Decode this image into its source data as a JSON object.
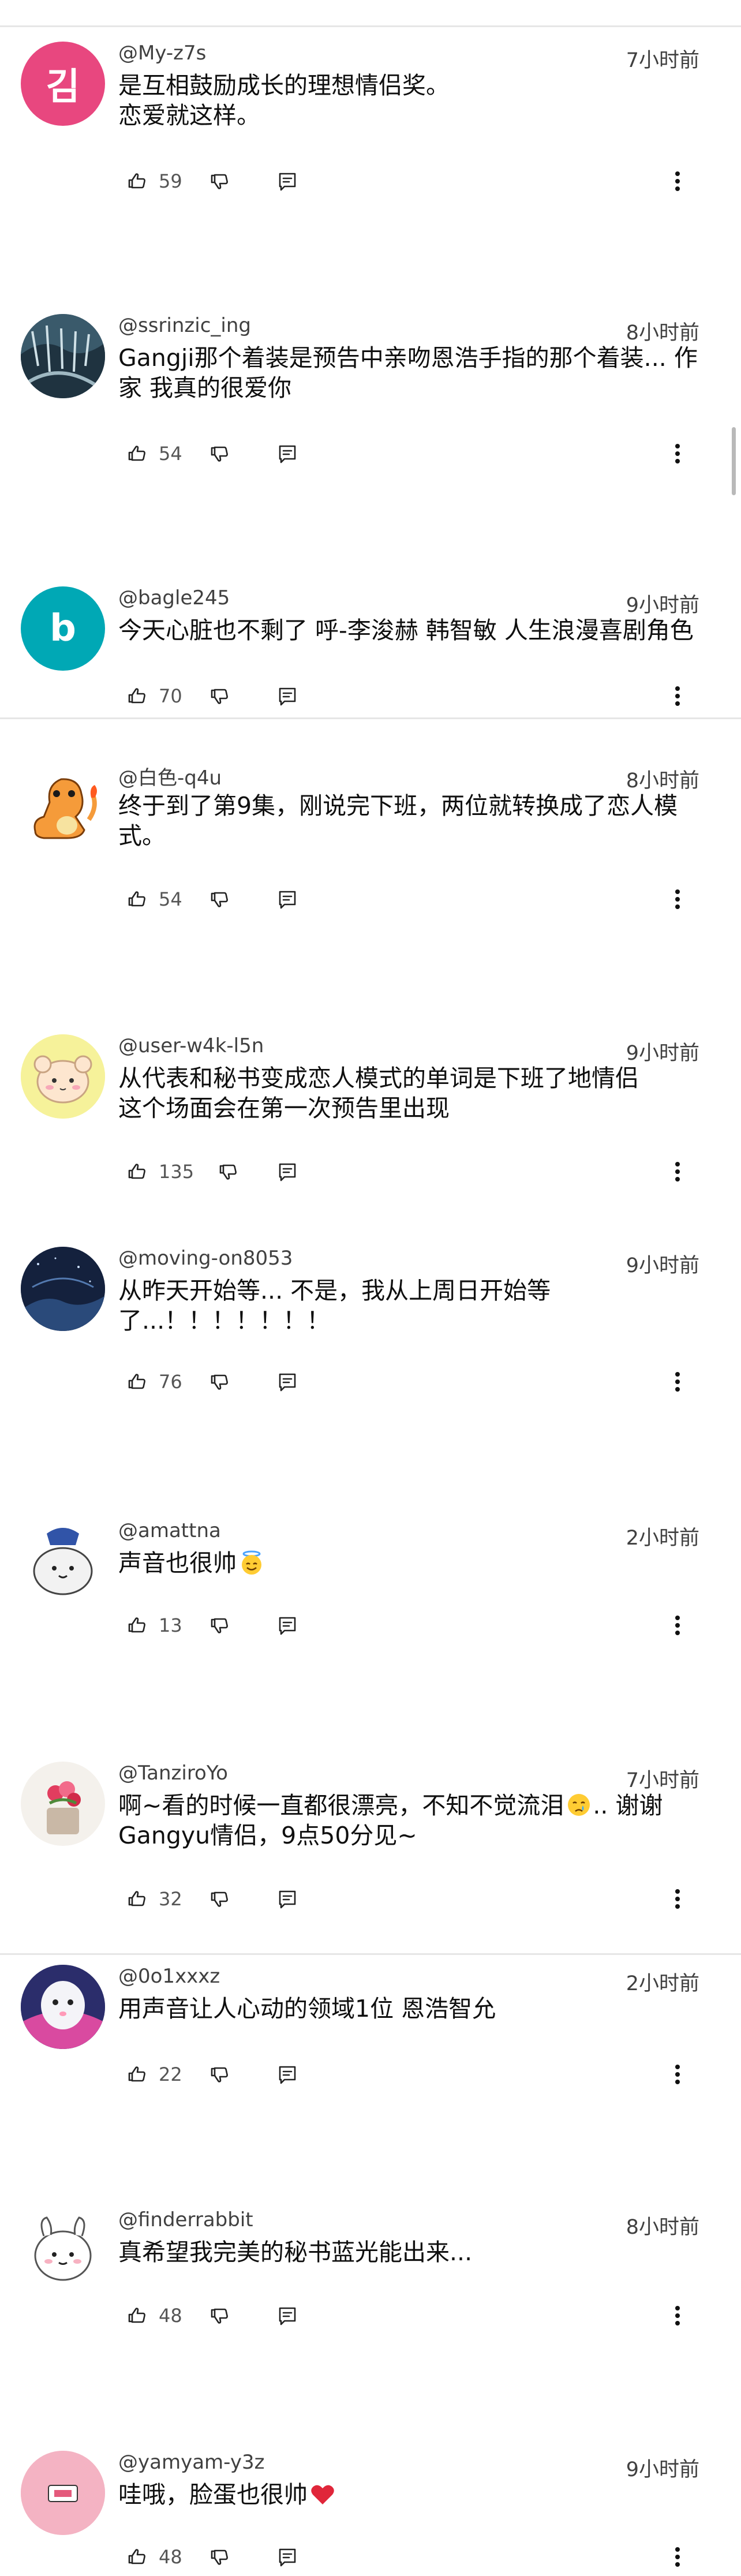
{
  "colors": {
    "text": "#0f0f0f",
    "meta": "#404040",
    "divider": "#e6e6e6",
    "avatar_letter_bg": "#e8477f",
    "avatar_b_bg": "#00a8b5"
  },
  "icons": {
    "like": "thumb-up-icon",
    "dislike": "thumb-down-icon",
    "reply": "reply-icon",
    "more": "more-vert-icon"
  },
  "comments": [
    {
      "author": "@My-z7s",
      "time": "7小时前",
      "text": "是互相鼓励成长的理想情侣奖。\n恋爱就这样。",
      "likes": "59",
      "avatar_letter": "김"
    },
    {
      "author": "@ssrinzic_ing",
      "time": "8小时前",
      "text": "Gangji那个着装是预告中亲吻恩浩手指的那个着装... 作家 我真的很爱你",
      "likes": "54"
    },
    {
      "author": "@bagle245",
      "time": "9小时前",
      "text": "今天心脏也不剩了 呼-李浚赫 韩智敏 人生浪漫喜剧角色",
      "likes": "70",
      "avatar_letter": "b"
    },
    {
      "author": "@白色-q4u",
      "time": "8小时前",
      "text": "终于到了第9集，刚说完下班，两位就转换成了恋人模式。",
      "likes": "54"
    },
    {
      "author": "@user-w4k-l5n",
      "time": "9小时前",
      "text": "从代表和秘书变成恋人模式的单词是下班了地情侣\n这个场面会在第一次预告里出现",
      "likes": "135"
    },
    {
      "author": "@moving-on8053",
      "time": "9小时前",
      "text": "从昨天开始等... 不是，我从上周日开始等了...！！！！！！！",
      "likes": "76"
    },
    {
      "author": "@amattna",
      "time": "2小时前",
      "text": "声音也很帅",
      "likes": "13"
    },
    {
      "author": "@TanziroYo",
      "time": "7小时前",
      "text": "啊~看的时候一直都很漂亮，不知不觉流泪",
      "text_after": ".. 谢谢Gangyu情侣，9点50分见~",
      "likes": "32"
    },
    {
      "author": "@0o1xxxz",
      "time": "2小时前",
      "text": "用声音让人心动的领域1位 恩浩智允",
      "likes": "22"
    },
    {
      "author": "@finderrabbit",
      "time": "8小时前",
      "text": "真希望我完美的秘书蓝光能出来...",
      "likes": "48"
    },
    {
      "author": "@yamyam-y3z",
      "time": "9小时前",
      "text": "哇哦，脸蛋也很帅",
      "likes": "48"
    }
  ]
}
